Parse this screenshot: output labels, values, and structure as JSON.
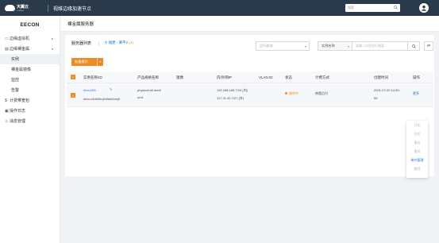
{
  "topbar": {
    "logo_text": "天翼云",
    "logo_sub": "e Cloud",
    "app_title": "视维边缘加速节点",
    "search_placeholder": "搜索"
  },
  "sidebar": {
    "brand": "EECON",
    "items": [
      {
        "label": "边缘虚拟机",
        "arrow": "▸"
      },
      {
        "label": "边缘裸金属",
        "arrow": "▾"
      },
      {
        "label": "实例"
      },
      {
        "label": "裸金属镜像"
      },
      {
        "label": "监控"
      },
      {
        "label": "告警"
      },
      {
        "label": "计费带宽包"
      },
      {
        "label": "操作日志"
      },
      {
        "label": "消息管理"
      }
    ]
  },
  "page": {
    "title": "裸金属服务器"
  },
  "toolbar": {
    "tab_label": "服务器列表",
    "region_label": "福建 - 莆平2",
    "region_count": "(1)",
    "status_placeholder": "运行状态",
    "field_select": "实例名称",
    "search_placeholder": "请输入内容进行搜索",
    "batch_label": "批量操作"
  },
  "table": {
    "columns": [
      "实例名称/ID",
      "产品规格名称",
      "镜像",
      "内/外网IP",
      "VLAN ID",
      "状态",
      "计费方式",
      "创建时间",
      "操作"
    ],
    "rows": [
      {
        "name": "ebm-f2t0",
        "id": "ebm-c3rfk0hu|fn0hkt0nnj0",
        "spec_line1": "physical.s6.medi",
        "spec_line2": "um1",
        "image": "",
        "ip_inner": "192.168.189.7/24 (内)",
        "ip_outer": "117.31.42.7/27 (外)",
        "vlan": "",
        "status": "操作中",
        "billing": "带宽后付",
        "created_line1": "2021-07-20 14:30:",
        "created_line2": "55",
        "action": "更多"
      }
    ]
  },
  "menu": {
    "items": [
      {
        "label": "开机",
        "enabled": false
      },
      {
        "label": "关机",
        "enabled": false
      },
      {
        "label": "重启",
        "enabled": false
      },
      {
        "label": "重装",
        "enabled": false
      },
      {
        "label": "带外管理",
        "enabled": true
      },
      {
        "label": "删除",
        "enabled": false
      }
    ]
  },
  "colors": {
    "topbar": "#2b3a4a",
    "accent": "#f08a24",
    "link": "#1f6fd6"
  }
}
